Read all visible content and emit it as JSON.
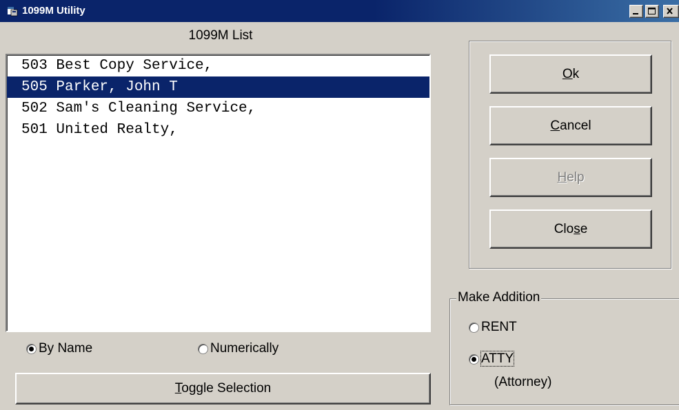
{
  "window": {
    "title": "1099M Utility"
  },
  "list": {
    "title": "1099M List",
    "items": [
      {
        "text": "503 Best Copy Service,",
        "selected": false
      },
      {
        "text": "505 Parker, John T",
        "selected": true
      },
      {
        "text": "502 Sam's Cleaning Service,",
        "selected": false
      },
      {
        "text": "501 United Realty,",
        "selected": false
      }
    ]
  },
  "sort": {
    "by_name": "By Name",
    "numerically": "Numerically",
    "selected": "by_name"
  },
  "toggle_selection": {
    "mn": "T",
    "rest": "oggle Selection"
  },
  "buttons": {
    "ok": {
      "pre": "",
      "mn": "O",
      "post": "k"
    },
    "cancel": {
      "pre": "",
      "mn": "C",
      "post": "ancel"
    },
    "help": {
      "pre": "",
      "mn": "H",
      "post": "elp",
      "disabled": true
    },
    "close": {
      "pre": "Clo",
      "mn": "s",
      "post": "e"
    }
  },
  "make_addition": {
    "title": "Make Addition",
    "rent": "RENT",
    "atty": "ATTY",
    "atty_desc": "(Attorney)",
    "selected": "atty"
  },
  "colors": {
    "selection": "#0a246a",
    "face": "#d4d0c8",
    "title_start": "#0a246a",
    "title_end": "#3a6ea5"
  }
}
